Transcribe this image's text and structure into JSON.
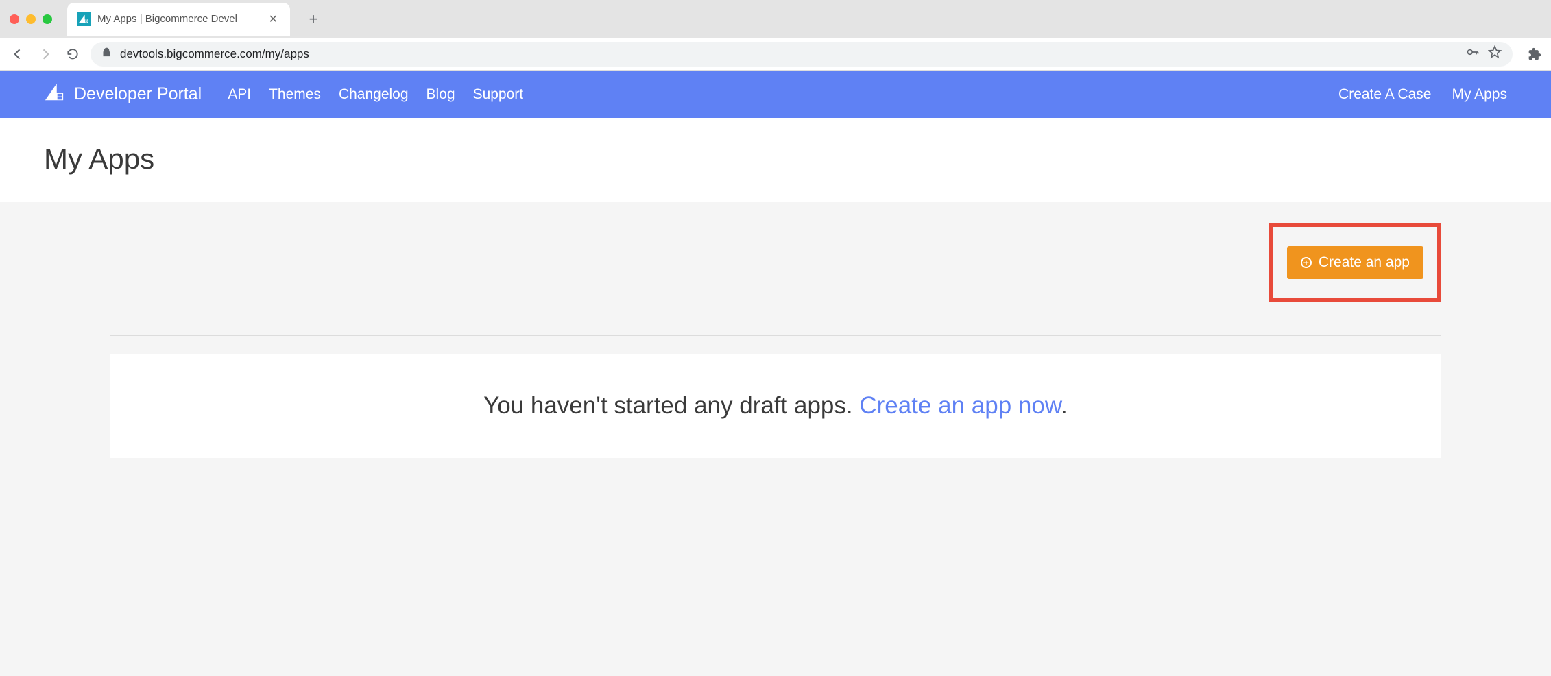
{
  "browser": {
    "tab_title": "My Apps | Bigcommerce Devel",
    "url": "devtools.bigcommerce.com/my/apps"
  },
  "header": {
    "logo_text": "Developer Portal",
    "nav": [
      "API",
      "Themes",
      "Changelog",
      "Blog",
      "Support"
    ],
    "right_nav": [
      "Create A Case",
      "My Apps"
    ]
  },
  "page": {
    "title": "My Apps",
    "create_button": "Create an app",
    "empty_text": "You haven't started any draft apps. ",
    "empty_link": "Create an app now",
    "empty_suffix": "."
  }
}
